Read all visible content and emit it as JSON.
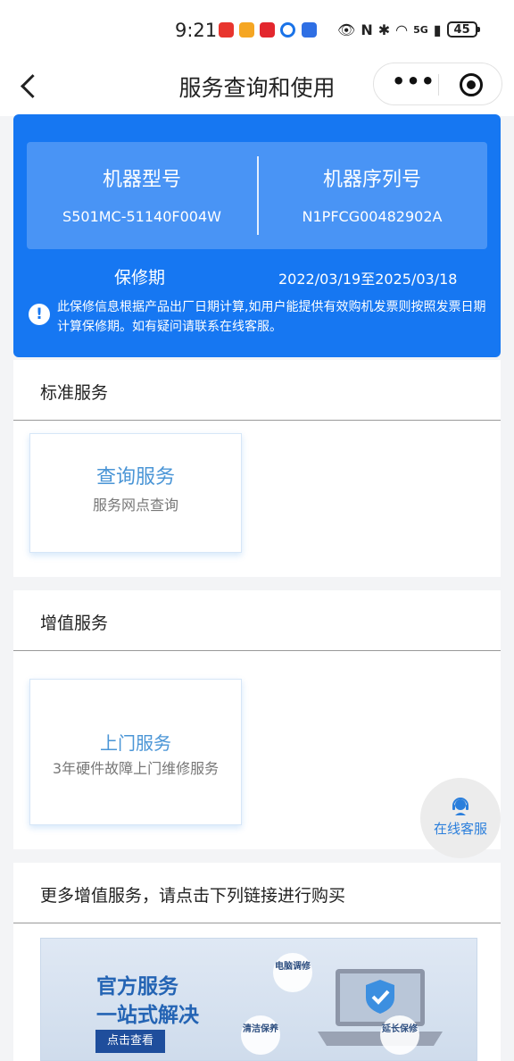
{
  "status_bar": {
    "time": "9:21",
    "network": "5G",
    "battery": "45",
    "notification_colors": [
      "#e8352e",
      "#f5a623",
      "#e3272e",
      "#1a73e8",
      "#2f6fe4"
    ]
  },
  "nav": {
    "title": "服务查询和使用",
    "more_icon": "more-dots-icon",
    "close_icon": "target-icon"
  },
  "device": {
    "model_label": "机器型号",
    "model_value": "S501MC-51140F004W",
    "serial_label": "机器序列号",
    "serial_value": "N1PFCG00482902A",
    "warranty_label": "保修期",
    "warranty_value": "2022/03/19至2025/03/18",
    "notice": "此保修信息根据产品出厂日期计算,如用户能提供有效购机发票则按照发票日期计算保修期。如有疑问请联系在线客服。"
  },
  "standard": {
    "title": "标准服务",
    "card_title": "查询服务",
    "card_sub": "服务网点查询"
  },
  "value_added": {
    "title": "增值服务",
    "card_title": "上门服务",
    "card_sub": "3年硬件故障上门维修服务"
  },
  "more": {
    "title": "更多增值服务，请点击下列链接进行购买",
    "banner": {
      "line1": "官方服务",
      "line2": "一站式解决",
      "button": "点击查看",
      "badge1": "电脑调修",
      "badge2": "清洁保养",
      "badge3": "延长保修"
    }
  },
  "float_service": {
    "label": "在线客服",
    "icon": "headset-icon"
  },
  "colors": {
    "primary": "#1677f2",
    "link": "#4a95d6"
  }
}
